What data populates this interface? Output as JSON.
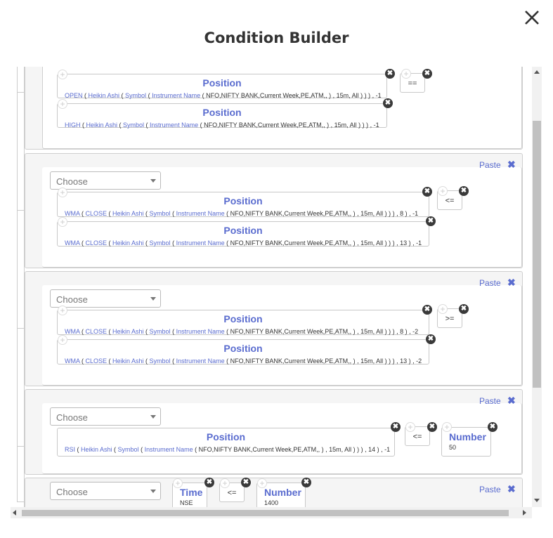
{
  "dialog": {
    "title": "Condition Builder"
  },
  "icons": {
    "close": "close-icon",
    "remove": "remove-circle-icon",
    "add": "add-circle-icon",
    "paste_x": "paste-remove-icon"
  },
  "colors": {
    "accent": "#5a6ccf",
    "remove_button": "#3a3a3a"
  },
  "common": {
    "paste_label": "Paste",
    "paste_x": "✖",
    "choose_label": "Choose",
    "position_label": "Position",
    "plus": "+",
    "x": "✖"
  },
  "blocks": [
    {
      "operator": "==",
      "left": {
        "parts": [
          [
            "OPEN",
            "fn"
          ],
          [
            " ( ",
            ""
          ],
          [
            "Heikin Ashi",
            "fn"
          ],
          [
            " ( ",
            ""
          ],
          [
            "Symbol",
            "fn"
          ],
          [
            " ( ",
            ""
          ],
          [
            "Instrument Name",
            "fn"
          ],
          [
            " ( NFO,NIFTY BANK,Current Week,PE,ATM,, ) , 15m, All ) ) ) , -1",
            ""
          ]
        ]
      },
      "right": {
        "parts": [
          [
            "HIGH",
            "fn"
          ],
          [
            " ( ",
            ""
          ],
          [
            "Heikin Ashi",
            "fn"
          ],
          [
            " ( ",
            ""
          ],
          [
            "Symbol",
            "fn"
          ],
          [
            " ( ",
            ""
          ],
          [
            "Instrument Name",
            "fn"
          ],
          [
            " ( NFO,NIFTY BANK,Current Week,PE,ATM,, ) , 15m, All ) ) ) , -1",
            ""
          ]
        ]
      }
    },
    {
      "operator": "<=",
      "left": {
        "parts": [
          [
            "WMA",
            "fn"
          ],
          [
            " ( ",
            ""
          ],
          [
            "CLOSE",
            "fn"
          ],
          [
            " ( ",
            ""
          ],
          [
            "Heikin Ashi",
            "fn"
          ],
          [
            " ( ",
            ""
          ],
          [
            "Symbol",
            "fn"
          ],
          [
            " ( ",
            ""
          ],
          [
            "Instrument Name",
            "fn"
          ],
          [
            " ( NFO,NIFTY BANK,Current Week,PE,ATM,, ) , 15m, All ) ) ) , 8 ) , -1",
            ""
          ]
        ]
      },
      "right": {
        "parts": [
          [
            "WMA",
            "fn"
          ],
          [
            " ( ",
            ""
          ],
          [
            "CLOSE",
            "fn"
          ],
          [
            " ( ",
            ""
          ],
          [
            "Heikin Ashi",
            "fn"
          ],
          [
            " ( ",
            ""
          ],
          [
            "Symbol",
            "fn"
          ],
          [
            " ( ",
            ""
          ],
          [
            "Instrument Name",
            "fn"
          ],
          [
            " ( NFO,NIFTY BANK,Current Week,PE,ATM,, ) , 15m, All ) ) ) , 13 ) , -1",
            ""
          ]
        ]
      }
    },
    {
      "operator": ">=",
      "left": {
        "parts": [
          [
            "WMA",
            "fn"
          ],
          [
            " ( ",
            ""
          ],
          [
            "CLOSE",
            "fn"
          ],
          [
            " ( ",
            ""
          ],
          [
            "Heikin Ashi",
            "fn"
          ],
          [
            " ( ",
            ""
          ],
          [
            "Symbol",
            "fn"
          ],
          [
            " ( ",
            ""
          ],
          [
            "Instrument Name",
            "fn"
          ],
          [
            " ( NFO,NIFTY BANK,Current Week,PE,ATM,, ) , 15m, All ) ) ) , 8 ) , -2",
            ""
          ]
        ]
      },
      "right": {
        "parts": [
          [
            "WMA",
            "fn"
          ],
          [
            " ( ",
            ""
          ],
          [
            "CLOSE",
            "fn"
          ],
          [
            " ( ",
            ""
          ],
          [
            "Heikin Ashi",
            "fn"
          ],
          [
            " ( ",
            ""
          ],
          [
            "Symbol",
            "fn"
          ],
          [
            " ( ",
            ""
          ],
          [
            "Instrument Name",
            "fn"
          ],
          [
            " ( NFO,NIFTY BANK,Current Week,PE,ATM,, ) , 15m, All ) ) ) , 13 ) , -2",
            ""
          ]
        ]
      }
    },
    {
      "operator": "<=",
      "left": {
        "parts": [
          [
            "RSI",
            "fn"
          ],
          [
            " ( ",
            ""
          ],
          [
            "Heikin Ashi",
            "fn"
          ],
          [
            " ( ",
            ""
          ],
          [
            "Symbol",
            "fn"
          ],
          [
            " ( ",
            ""
          ],
          [
            "Instrument Name",
            "fn"
          ],
          [
            " ( NFO,NIFTY BANK,Current Week,PE,ATM,, ) , 15m, All ) ) ) , 14 ) , -1",
            ""
          ]
        ]
      },
      "number": {
        "label": "Number",
        "value": "50"
      }
    },
    {
      "operator": "<=",
      "time": {
        "label": "Time",
        "value": "NSE"
      },
      "number": {
        "label": "Number",
        "value": "1400"
      }
    }
  ]
}
